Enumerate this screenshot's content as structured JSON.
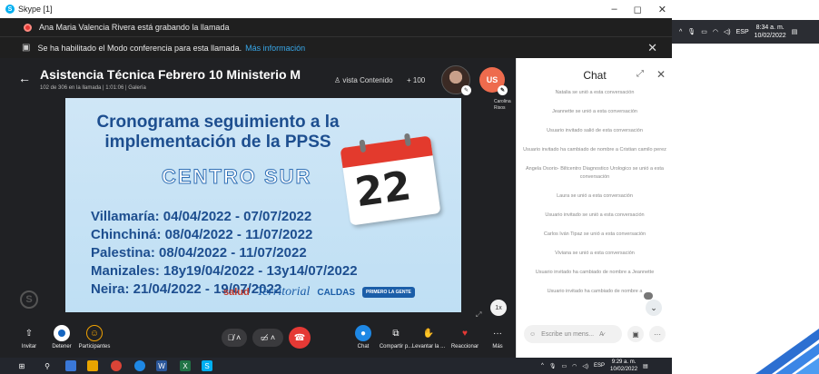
{
  "window": {
    "title": "Skype [1]",
    "minimize": "–",
    "maximize": "◻",
    "close": "✕"
  },
  "banners": {
    "recording": "Ana Maria Valencia Rivera está grabando la llamada",
    "conference": "Se ha habilitado el Modo conferencia para esta llamada.",
    "more_info": "Más información",
    "close": "✕"
  },
  "call": {
    "title": "Asistencia Técnica Febrero 10 Ministerio M",
    "subtitle": "102 de 306 en la llamada | 1:01:06 | Galería",
    "view_content": "vista Contenido",
    "participants_extra": "+ 100",
    "avatar_initials": "US",
    "participant_name": "Carolina Risos",
    "speed_label": "1x"
  },
  "slide": {
    "title_line1": "Cronograma seguimiento a la",
    "title_line2": "implementación de la PPSS",
    "region": "CENTRO SUR",
    "calendar_day": "22",
    "rows": [
      "Villamaría: 04/04/2022   -  07/07/2022",
      "Chinchiná: 08/04/2022   -   11/07/2022",
      "Palestina:  08/04/2022   -   11/07/2022",
      "Manizales: 18y19/04/2022 - 13y14/07/2022",
      "Neira:        21/04/2022     -  19/07/2022"
    ],
    "logos": {
      "salud": "salud",
      "territorial": "Territorial",
      "caldas": "CALDAS",
      "primero": "PRIMERO LA GENTE"
    }
  },
  "callbar": {
    "invite": "Invitar",
    "stop": "Detener",
    "participants": "Participantes",
    "chat": "Chat",
    "share": "Compartir p...",
    "raise": "Levantar la ...",
    "react": "Reaccionar",
    "more": "Más"
  },
  "chat": {
    "title": "Chat",
    "messages": [
      "Natalia se unió a esta conversación",
      "Jeannette se unió a esta conversación",
      "Usuario invitado salió de esta conversación",
      "Usuario invitado ha cambiado de nombre a Cristian camilo perez",
      "Angela Osorio- Biltcentro Diagnostico Urologico se unió a esta conversación",
      "Laura se unió a esta conversación",
      "Usuario invitado se unió a esta conversación",
      "Carlos Iván Tipaz se unió a esta conversación",
      "Viviana se unió a esta conversación",
      "Usuario invitado ha cambiado de nombre a Jeannette",
      "Usuario invitado ha cambiado de nombre a"
    ],
    "input_placeholder": "Escribe un mens..."
  },
  "tray_top": {
    "lang": "ESP",
    "time": "8:34 a. m.",
    "date": "10/02/2022"
  },
  "taskbar": {
    "lang": "ESP",
    "time": "9:29 a. m.",
    "date": "10/02/2022"
  },
  "colors": {
    "accent": "#00aff0",
    "hangup": "#e53935",
    "avatar_us": "#ee6b4d",
    "slide_blue": "#1d4e8f"
  }
}
